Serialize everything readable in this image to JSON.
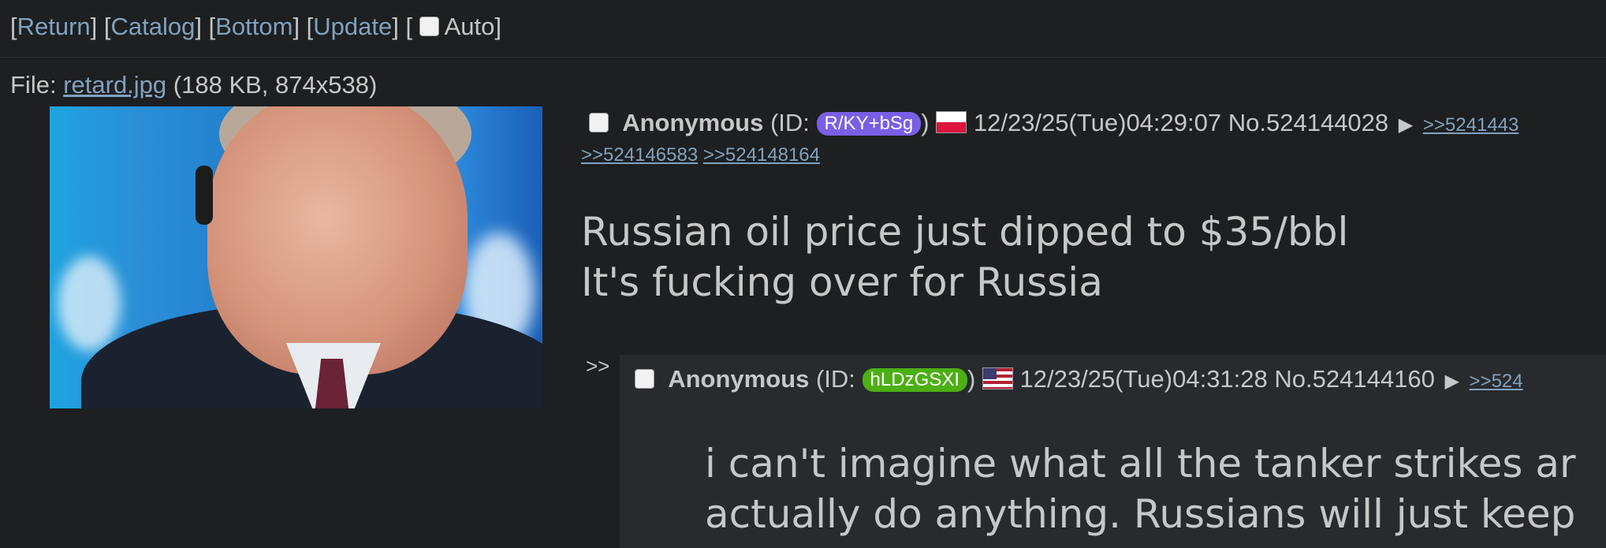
{
  "nav": {
    "return": "Return",
    "catalog": "Catalog",
    "bottom": "Bottom",
    "update": "Update",
    "auto": "Auto"
  },
  "file": {
    "prefix": "File:",
    "name": "retard.jpg",
    "meta": "(188 KB, 874x538)"
  },
  "op": {
    "name": "Anonymous",
    "id_prefix": "(ID:",
    "id": "R/KY+bSg",
    "id_color": "#7a5ee6",
    "id_suffix": ")",
    "flag": "poland-flag",
    "datetime": "12/23/25(Tue)04:29:07",
    "number": "No.524144028",
    "backlinks": [
      ">>5241443",
      ">>524146583",
      ">>524148164"
    ],
    "text_line1": "Russian oil price just dipped to $35/bbl",
    "text_line2": "It's fucking over for Russia"
  },
  "reply": {
    "side_arrows": ">>",
    "name": "Anonymous",
    "id_prefix": "(ID:",
    "id": "hLDzGSXI",
    "id_color": "#4caf14",
    "id_suffix": ")",
    "flag": "usa-flag",
    "datetime": "12/23/25(Tue)04:31:28",
    "number": "No.524144160",
    "backlink": ">>524",
    "text_line1": "i can't imagine what all the tanker strikes ar",
    "text_line2": "actually do anything. Russians will just keep"
  }
}
